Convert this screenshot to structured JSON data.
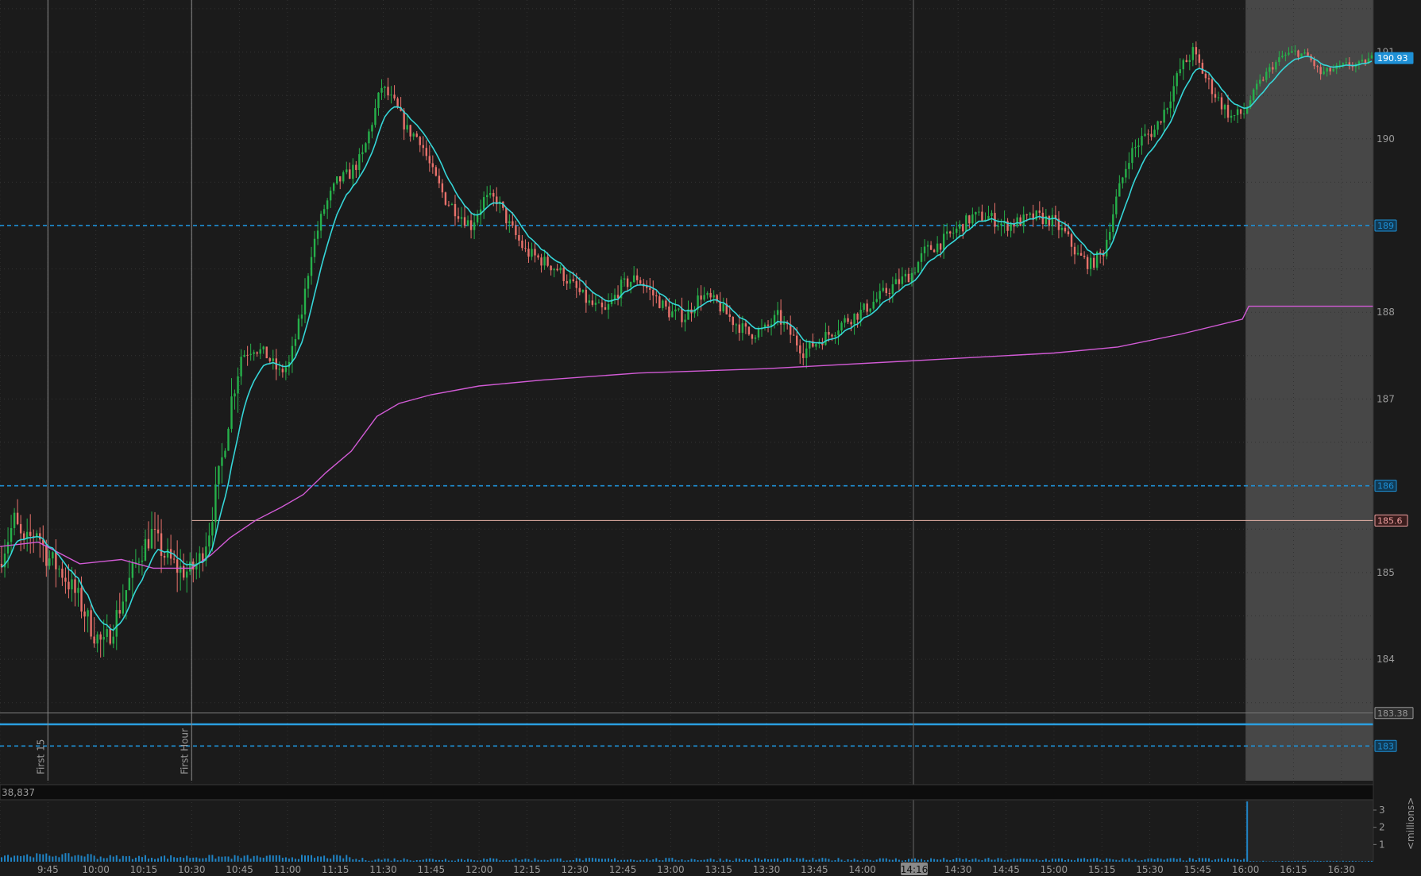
{
  "chart_data": {
    "type": "candlestick",
    "price_axis": {
      "ticks": [
        "184",
        "185",
        "186",
        "187",
        "188",
        "189",
        "190",
        "191"
      ],
      "range": [
        182.6,
        191.6
      ]
    },
    "time_axis": {
      "ticks": [
        "9:45",
        "10:00",
        "10:15",
        "10:30",
        "10:45",
        "11:00",
        "11:15",
        "11:30",
        "11:45",
        "12:00",
        "12:15",
        "12:30",
        "12:45",
        "13:00",
        "13:15",
        "13:30",
        "13:45",
        "14:00",
        "14:30",
        "14:45",
        "15:00",
        "15:15",
        "15:30",
        "15:45",
        "16:00",
        "16:15",
        "16:30"
      ],
      "cursor_label": "14:16",
      "range_minutes": [
        570,
        1000
      ]
    },
    "markers": [
      {
        "label": "First 15",
        "time": 585
      },
      {
        "label": "First Hour",
        "time": 630
      }
    ],
    "price_tags": [
      {
        "label": "190.93",
        "value": 190.93,
        "kind": "last",
        "color": "#1e90d6"
      },
      {
        "label": "189",
        "value": 189,
        "kind": "level",
        "color": "#1e90d6"
      },
      {
        "label": "186",
        "value": 186,
        "kind": "level",
        "color": "#1e90d6"
      },
      {
        "label": "185.6",
        "value": 185.6,
        "kind": "open",
        "color": "#f0a0a0"
      },
      {
        "label": "183.38",
        "value": 183.38,
        "kind": "prev-close",
        "color": "#9a9a9a"
      },
      {
        "label": "183",
        "value": 183,
        "kind": "level",
        "color": "#1e90d6"
      }
    ],
    "solid_level": {
      "value": 183.25,
      "color": "#2b9fe0"
    },
    "prev_close_line": 183.38,
    "open_line": {
      "value": 185.6,
      "from_time": 630
    },
    "after_hours_start": 960,
    "cursor_time": 856,
    "price_path": [
      [
        570,
        185.1
      ],
      [
        575,
        185.6
      ],
      [
        578,
        185.3
      ],
      [
        582,
        185.5
      ],
      [
        585,
        185.2
      ],
      [
        590,
        185.0
      ],
      [
        595,
        184.7
      ],
      [
        600,
        184.3
      ],
      [
        603,
        184.15
      ],
      [
        606,
        184.4
      ],
      [
        610,
        184.8
      ],
      [
        614,
        185.2
      ],
      [
        618,
        185.45
      ],
      [
        622,
        185.2
      ],
      [
        626,
        185.05
      ],
      [
        630,
        185.0
      ],
      [
        633,
        185.15
      ],
      [
        636,
        185.5
      ],
      [
        640,
        186.3
      ],
      [
        643,
        187.0
      ],
      [
        646,
        187.5
      ],
      [
        650,
        187.6
      ],
      [
        654,
        187.5
      ],
      [
        658,
        187.3
      ],
      [
        661,
        187.4
      ],
      [
        665,
        188.0
      ],
      [
        668,
        188.7
      ],
      [
        672,
        189.2
      ],
      [
        676,
        189.5
      ],
      [
        680,
        189.6
      ],
      [
        684,
        189.8
      ],
      [
        687,
        190.2
      ],
      [
        690,
        190.6
      ],
      [
        694,
        190.4
      ],
      [
        698,
        190.1
      ],
      [
        702,
        190.0
      ],
      [
        706,
        189.6
      ],
      [
        710,
        189.3
      ],
      [
        714,
        189.15
      ],
      [
        718,
        189.0
      ],
      [
        722,
        189.3
      ],
      [
        726,
        189.3
      ],
      [
        730,
        189.0
      ],
      [
        735,
        188.7
      ],
      [
        740,
        188.6
      ],
      [
        745,
        188.5
      ],
      [
        750,
        188.3
      ],
      [
        755,
        188.1
      ],
      [
        760,
        188.0
      ],
      [
        765,
        188.3
      ],
      [
        770,
        188.4
      ],
      [
        775,
        188.2
      ],
      [
        780,
        188.0
      ],
      [
        785,
        187.95
      ],
      [
        790,
        188.2
      ],
      [
        795,
        188.1
      ],
      [
        800,
        187.9
      ],
      [
        805,
        187.75
      ],
      [
        810,
        187.8
      ],
      [
        814,
        187.95
      ],
      [
        818,
        187.75
      ],
      [
        822,
        187.55
      ],
      [
        826,
        187.65
      ],
      [
        830,
        187.75
      ],
      [
        835,
        187.9
      ],
      [
        840,
        188.0
      ],
      [
        845,
        188.15
      ],
      [
        850,
        188.3
      ],
      [
        856,
        188.45
      ],
      [
        860,
        188.7
      ],
      [
        865,
        188.8
      ],
      [
        870,
        188.95
      ],
      [
        875,
        189.1
      ],
      [
        880,
        189.1
      ],
      [
        885,
        189.0
      ],
      [
        890,
        189.05
      ],
      [
        895,
        189.1
      ],
      [
        900,
        189.05
      ],
      [
        904,
        188.9
      ],
      [
        908,
        188.65
      ],
      [
        912,
        188.55
      ],
      [
        916,
        188.7
      ],
      [
        920,
        189.3
      ],
      [
        924,
        189.8
      ],
      [
        928,
        190.0
      ],
      [
        932,
        190.1
      ],
      [
        936,
        190.4
      ],
      [
        940,
        190.8
      ],
      [
        944,
        191.0
      ],
      [
        948,
        190.7
      ],
      [
        952,
        190.45
      ],
      [
        956,
        190.25
      ],
      [
        960,
        190.3
      ],
      [
        964,
        190.6
      ],
      [
        968,
        190.8
      ],
      [
        972,
        190.95
      ],
      [
        976,
        191.0
      ],
      [
        980,
        190.95
      ],
      [
        984,
        190.75
      ],
      [
        988,
        190.8
      ],
      [
        992,
        190.85
      ],
      [
        996,
        190.85
      ],
      [
        1000,
        190.93
      ]
    ],
    "vwap_path": [
      [
        570,
        185.3
      ],
      [
        582,
        185.35
      ],
      [
        595,
        185.1
      ],
      [
        608,
        185.15
      ],
      [
        618,
        185.05
      ],
      [
        630,
        185.05
      ],
      [
        636,
        185.2
      ],
      [
        642,
        185.4
      ],
      [
        650,
        185.6
      ],
      [
        658,
        185.75
      ],
      [
        665,
        185.9
      ],
      [
        672,
        186.15
      ],
      [
        680,
        186.4
      ],
      [
        688,
        186.8
      ],
      [
        695,
        186.95
      ],
      [
        705,
        187.05
      ],
      [
        720,
        187.15
      ],
      [
        740,
        187.22
      ],
      [
        770,
        187.3
      ],
      [
        810,
        187.35
      ],
      [
        860,
        187.45
      ],
      [
        900,
        187.53
      ],
      [
        920,
        187.6
      ],
      [
        940,
        187.75
      ],
      [
        959,
        187.92
      ],
      [
        961,
        188.07
      ],
      [
        1000,
        188.07
      ]
    ],
    "volume_axis": {
      "ticks": [
        "1",
        "2",
        "3"
      ],
      "unit": "<millions>",
      "max": 3.6
    },
    "volume_readout": "38,837",
    "volume_spike": {
      "time": 960,
      "value": 3.5
    }
  }
}
